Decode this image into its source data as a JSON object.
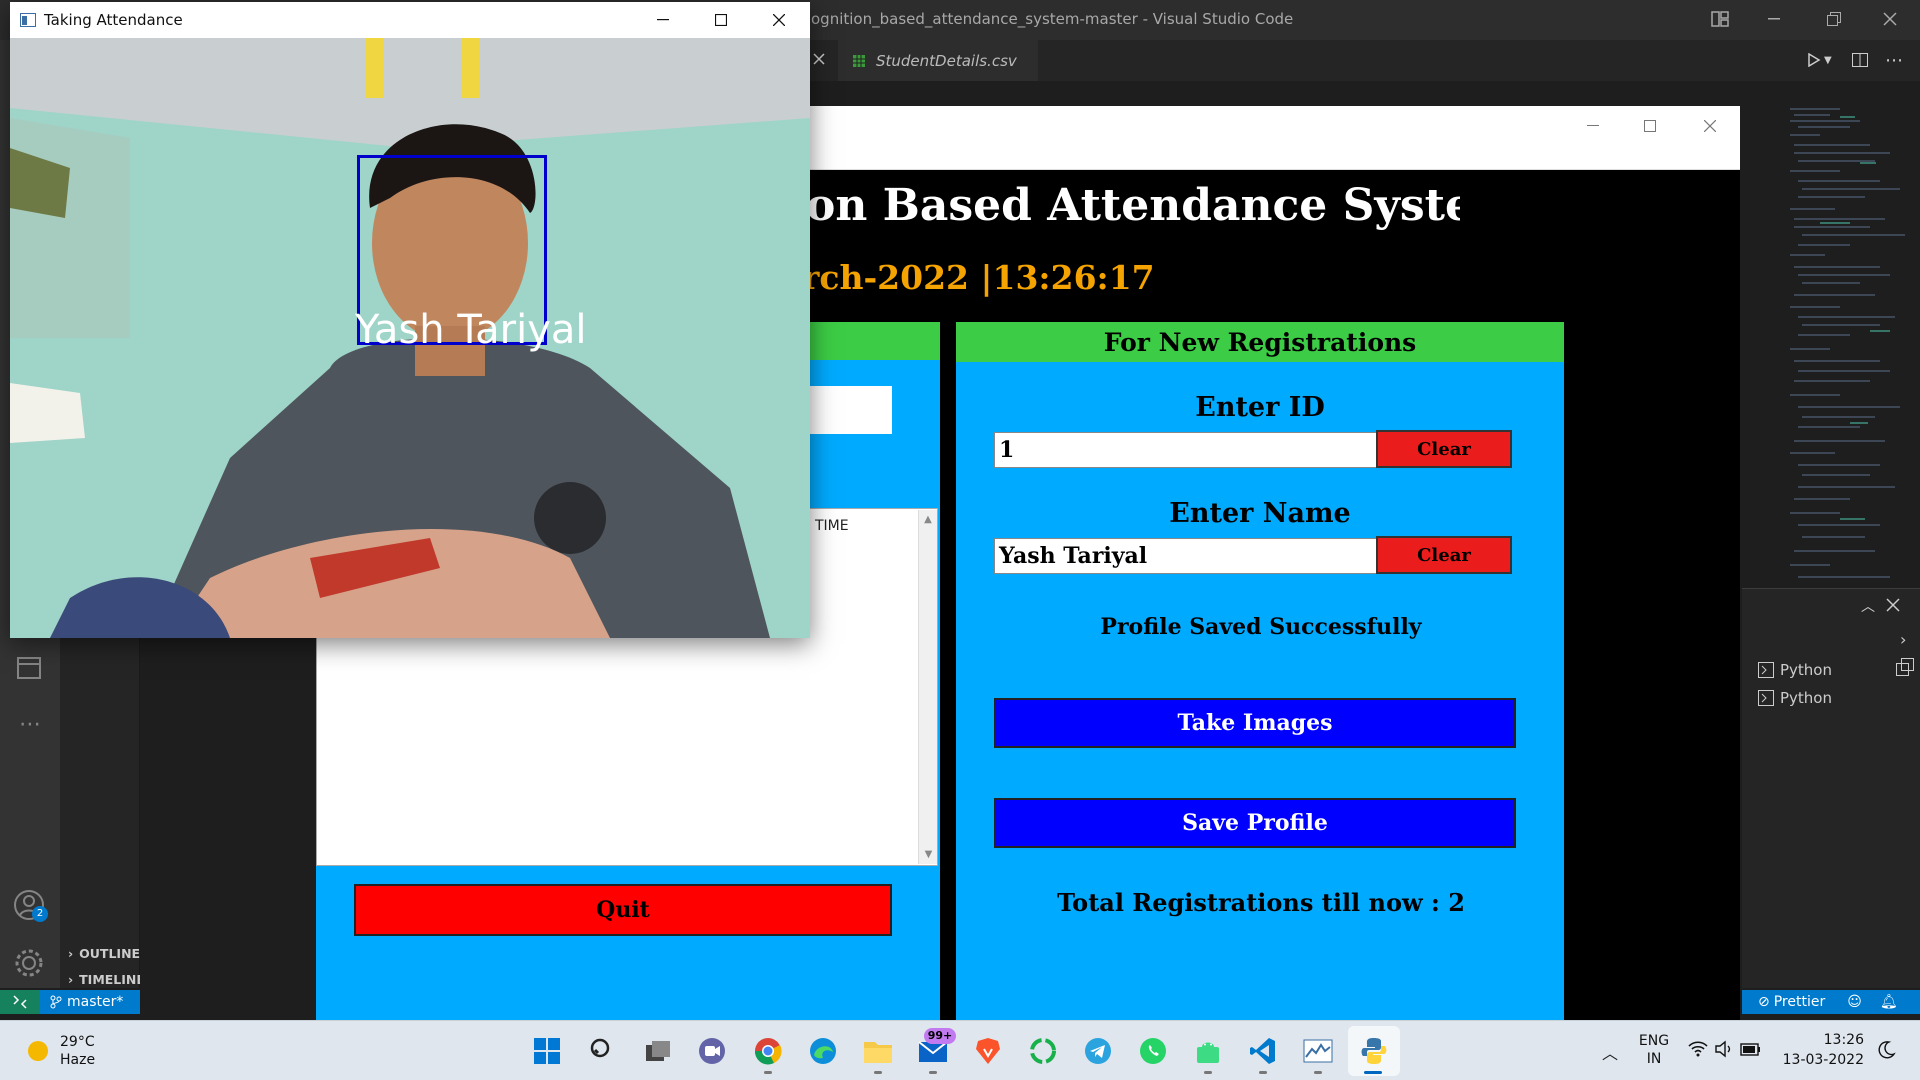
{
  "vscode": {
    "title": "ognition_based_attendance_system-master - Visual Studio Code",
    "tab_label": "StudentDetails.csv",
    "outline_label": "OUTLINE",
    "timeline_label": "TIMELINE",
    "branch": "master*",
    "badge_count": "2",
    "terminals": [
      "Python",
      "Python"
    ],
    "prettier": "Prettier"
  },
  "attendance_app": {
    "heading": "on Based Attendance System",
    "datetime": "rch-2022  |13:26:17",
    "left_panel": {
      "tree_column": "TIME",
      "quit_label": "Quit"
    },
    "right_panel": {
      "header": "For New Registrations",
      "id_label": "Enter ID",
      "id_value": "1",
      "name_label": "Enter Name",
      "name_value": "Yash Tariyal",
      "clear_label": "Clear",
      "status_message": "Profile Saved Successfully",
      "take_images_label": "Take Images",
      "save_profile_label": "Save Profile",
      "total_registrations": "Total Registrations till now  : 2"
    }
  },
  "camera_window": {
    "title": "Taking Attendance",
    "face_name": "Yash  Tariyal"
  },
  "taskbar": {
    "weather_temp": "29°C",
    "weather_desc": "Haze",
    "mail_badge": "99+",
    "lang_top": "ENG",
    "lang_bottom": "IN",
    "time": "13:26",
    "date": "13-03-2022"
  },
  "colors": {
    "tk_blue": "#00aaff",
    "tk_green": "#3ccc45",
    "button_blue": "#0000ff",
    "button_red": "#ff0000",
    "vscode_accent": "#007acc"
  }
}
